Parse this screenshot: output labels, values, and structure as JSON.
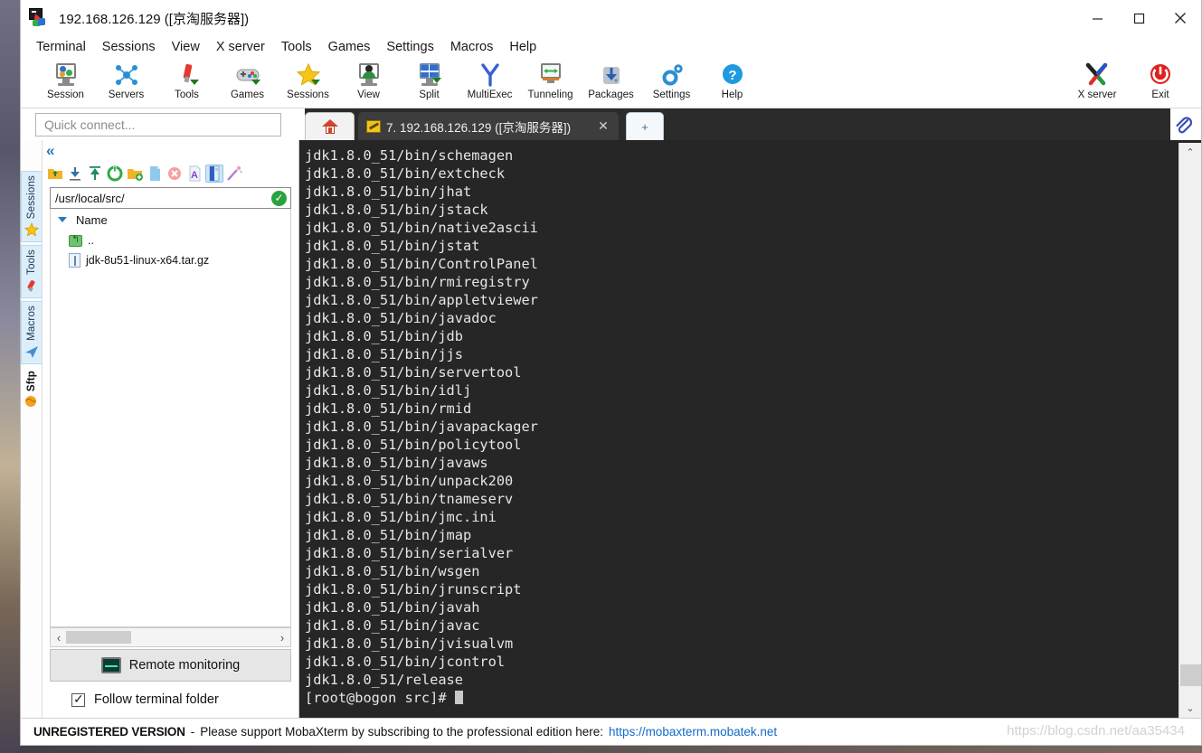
{
  "window": {
    "title": "192.168.126.129 ([京淘服务器])",
    "logo_icon": "mobaxterm-logo-icon",
    "controls": {
      "minimize": "minimize-icon",
      "maximize": "maximize-icon",
      "close": "close-icon"
    }
  },
  "menu": {
    "items": [
      {
        "label": "Terminal"
      },
      {
        "label": "Sessions"
      },
      {
        "label": "View"
      },
      {
        "label": "X server"
      },
      {
        "label": "Tools"
      },
      {
        "label": "Games"
      },
      {
        "label": "Settings"
      },
      {
        "label": "Macros"
      },
      {
        "label": "Help"
      }
    ]
  },
  "toolbar": {
    "buttons": [
      {
        "label": "Session",
        "icon": "session-monitor-icon"
      },
      {
        "label": "Servers",
        "icon": "servers-network-icon"
      },
      {
        "label": "Tools",
        "icon": "tools-screwdriver-icon"
      },
      {
        "label": "Games",
        "icon": "games-gamepad-icon"
      },
      {
        "label": "Sessions",
        "icon": "sessions-star-icon"
      },
      {
        "label": "View",
        "icon": "view-person-monitor-icon"
      },
      {
        "label": "Split",
        "icon": "split-grid-icon"
      },
      {
        "label": "MultiExec",
        "icon": "multiexec-fork-icon"
      },
      {
        "label": "Tunneling",
        "icon": "tunneling-arrows-icon"
      },
      {
        "label": "Packages",
        "icon": "packages-download-icon"
      },
      {
        "label": "Settings",
        "icon": "settings-gear-icon"
      },
      {
        "label": "Help",
        "icon": "help-question-icon"
      }
    ],
    "right_buttons": [
      {
        "label": "X server",
        "icon": "xserver-x-icon"
      },
      {
        "label": "Exit",
        "icon": "exit-power-icon"
      }
    ]
  },
  "quick_connect": {
    "placeholder": "Quick connect...",
    "value": ""
  },
  "tabs": {
    "home_icon": "home-icon",
    "session": {
      "icon": "ssh-key-icon",
      "label": "7.  192.168.126.129  ([京淘服务器])",
      "close_label": "✕"
    },
    "add_label": "+",
    "paperclip_icon": "paperclip-icon"
  },
  "rail": {
    "collapse_label": "«",
    "items": [
      {
        "label": "Sessions",
        "icon": "star-icon"
      },
      {
        "label": "Tools",
        "icon": "wrench-icon"
      },
      {
        "label": "Macros",
        "icon": "paper-plane-icon"
      },
      {
        "label": "Sftp",
        "icon": "globe-icon"
      }
    ]
  },
  "sftp": {
    "toolbar_icons": [
      {
        "name": "go-up-folder-icon",
        "selected": false
      },
      {
        "name": "download-icon",
        "selected": false
      },
      {
        "name": "upload-icon",
        "selected": false
      },
      {
        "name": "refresh-icon",
        "selected": false
      },
      {
        "name": "new-folder-icon",
        "selected": false
      },
      {
        "name": "new-file-icon",
        "selected": false
      },
      {
        "name": "delete-icon",
        "selected": false
      },
      {
        "name": "text-edit-icon",
        "selected": false
      },
      {
        "name": "toggle-panel-icon",
        "selected": true
      },
      {
        "name": "magic-wand-icon",
        "selected": false
      }
    ],
    "path": "/usr/local/src/",
    "path_ok_icon": "check-circle-icon",
    "column_header": "Name",
    "files": [
      {
        "name": "..",
        "icon": "parent-folder-icon"
      },
      {
        "name": "jdk-8u51-linux-x64.tar.gz",
        "icon": "archive-file-icon"
      }
    ],
    "hscroll": {
      "left_arrow": "‹",
      "right_arrow": "›"
    },
    "remote_monitoring_label": "Remote monitoring",
    "remote_monitoring_icon": "monitor-graph-icon",
    "follow_terminal_folder_label": "Follow terminal folder",
    "follow_terminal_folder_checked": true
  },
  "terminal": {
    "lines": [
      "jdk1.8.0_51/bin/schemagen",
      "jdk1.8.0_51/bin/extcheck",
      "jdk1.8.0_51/bin/jhat",
      "jdk1.8.0_51/bin/jstack",
      "jdk1.8.0_51/bin/native2ascii",
      "jdk1.8.0_51/bin/jstat",
      "jdk1.8.0_51/bin/ControlPanel",
      "jdk1.8.0_51/bin/rmiregistry",
      "jdk1.8.0_51/bin/appletviewer",
      "jdk1.8.0_51/bin/javadoc",
      "jdk1.8.0_51/bin/jdb",
      "jdk1.8.0_51/bin/jjs",
      "jdk1.8.0_51/bin/servertool",
      "jdk1.8.0_51/bin/idlj",
      "jdk1.8.0_51/bin/rmid",
      "jdk1.8.0_51/bin/javapackager",
      "jdk1.8.0_51/bin/policytool",
      "jdk1.8.0_51/bin/javaws",
      "jdk1.8.0_51/bin/unpack200",
      "jdk1.8.0_51/bin/tnameserv",
      "jdk1.8.0_51/bin/jmc.ini",
      "jdk1.8.0_51/bin/jmap",
      "jdk1.8.0_51/bin/serialver",
      "jdk1.8.0_51/bin/wsgen",
      "jdk1.8.0_51/bin/jrunscript",
      "jdk1.8.0_51/bin/javah",
      "jdk1.8.0_51/bin/javac",
      "jdk1.8.0_51/bin/jvisualvm",
      "jdk1.8.0_51/bin/jcontrol",
      "jdk1.8.0_51/release"
    ],
    "prompt": "[root@bogon src]# ",
    "scrollbar": {
      "up_arrow": "⌃",
      "down_arrow": "⌄"
    }
  },
  "status_bar": {
    "unregistered": "UNREGISTERED VERSION",
    "separator": "-",
    "message": "Please support MobaXterm by subscribing to the professional edition here:",
    "link": "https://mobaxterm.mobatek.net"
  },
  "watermark": "https://blog.csdn.net/aa35434",
  "colors": {
    "terminal_bg": "#262626",
    "terminal_fg": "#e6e6e6",
    "accent_blue": "#2a7ab8",
    "link_blue": "#1569c7",
    "tab_active_bg": "#3d3d3d"
  }
}
